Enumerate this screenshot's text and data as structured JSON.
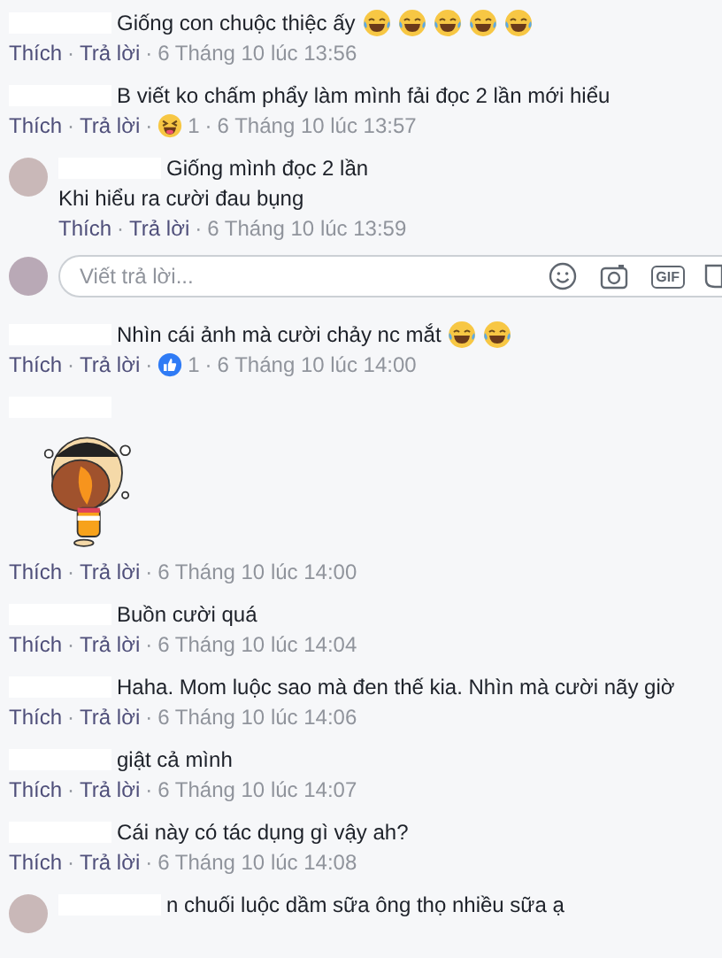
{
  "separator": "·",
  "comments": [
    {
      "kind": "comment",
      "author_redacted": true,
      "text": "Giống con chuộc thiệc ấy",
      "emojis": [
        {
          "kind": "joy"
        },
        {
          "kind": "joy"
        },
        {
          "kind": "joy"
        },
        {
          "kind": "joy"
        },
        {
          "kind": "joy"
        }
      ],
      "like": "Thích",
      "reply": "Trả lời",
      "time": "6 Tháng 10 lúc 13:56"
    },
    {
      "kind": "comment",
      "author_redacted": true,
      "text": "B viết ko chấm phẩy làm mình fải đọc 2 lần mới hiểu",
      "like": "Thích",
      "reply": "Trả lời",
      "reaction": {
        "kind": "haha",
        "count": "1"
      },
      "time": "6 Tháng 10 lúc 13:57"
    },
    {
      "kind": "comment",
      "avatar": true,
      "author_redacted": true,
      "text": "Giống mình đọc 2 lần",
      "text2": "Khi hiểu ra cười đau bụng",
      "like": "Thích",
      "reply": "Trả lời",
      "time": "6 Tháng 10 lúc 13:59"
    },
    {
      "kind": "reply_box",
      "placeholder": "Viết trả lời...",
      "gif_label": "GIF"
    },
    {
      "kind": "comment",
      "author_redacted": true,
      "text": "Nhìn cái ảnh mà cười chảy nc mắt",
      "emojis": [
        {
          "kind": "joy"
        },
        {
          "kind": "joy"
        }
      ],
      "like": "Thích",
      "reply": "Trả lời",
      "reaction": {
        "kind": "like",
        "count": "1"
      },
      "time": "6 Tháng 10 lúc 14:00"
    },
    {
      "kind": "sticker",
      "author_redacted": true,
      "like": "Thích",
      "reply": "Trả lời",
      "time": "6 Tháng 10 lúc 14:00"
    },
    {
      "kind": "comment",
      "author_redacted": true,
      "text": "Buồn cười quá",
      "like": "Thích",
      "reply": "Trả lời",
      "time": "6 Tháng 10 lúc 14:04"
    },
    {
      "kind": "comment",
      "author_redacted": true,
      "text": "Haha. Mom luộc sao mà đen thế kia. Nhìn mà cười nãy giờ",
      "like": "Thích",
      "reply": "Trả lời",
      "time": "6 Tháng 10 lúc 14:06"
    },
    {
      "kind": "comment",
      "author_redacted": true,
      "text": "giật cả mình",
      "like": "Thích",
      "reply": "Trả lời",
      "time": "6 Tháng 10 lúc 14:07"
    },
    {
      "kind": "comment",
      "author_redacted": true,
      "text": "Cái này có tác dụng gì vậy ah?",
      "like": "Thích",
      "reply": "Trả lời",
      "time": "6 Tháng 10 lúc 14:08"
    },
    {
      "kind": "comment",
      "avatar": true,
      "author_redacted": true,
      "text": "n chuối luộc dầm sữa ông thọ nhiều sữa ạ"
    }
  ]
}
